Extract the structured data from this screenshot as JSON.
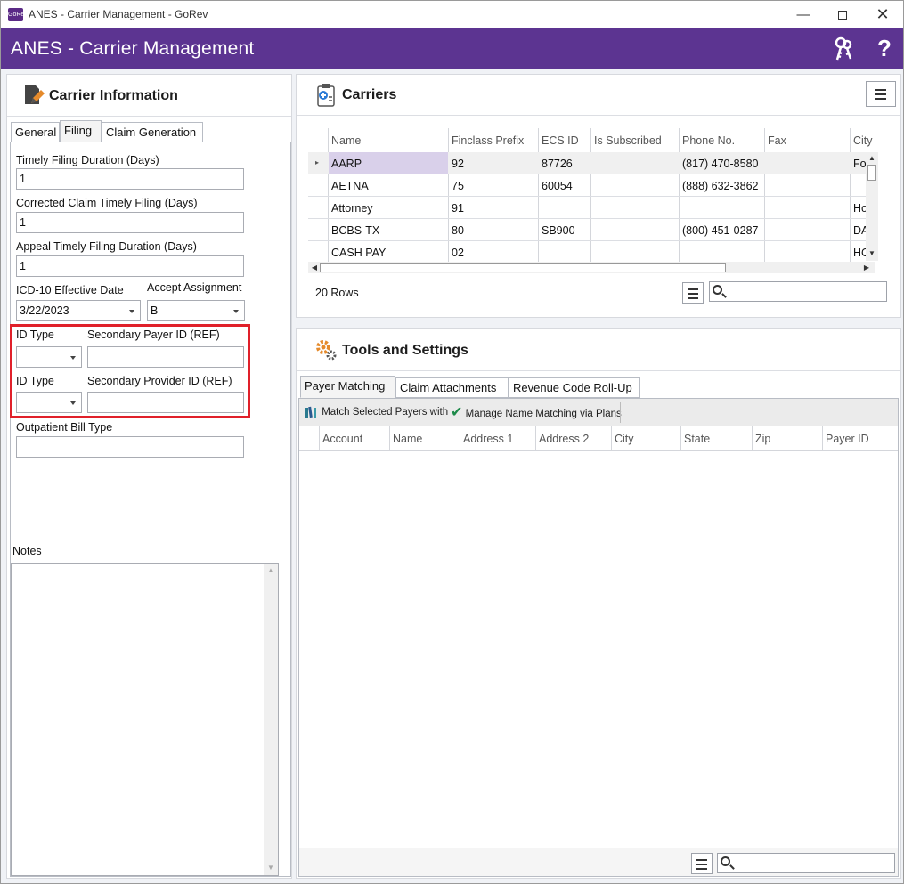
{
  "window": {
    "title": "ANES - Carrier Management - GoRev",
    "logo_text": "GoRev"
  },
  "header": {
    "app_name": "ANES - Carrier Management"
  },
  "carrier_info": {
    "title": "Carrier Information",
    "tabs": [
      "General",
      "Filing",
      "Claim Generation"
    ],
    "active_tab": "Filing",
    "fields": {
      "timely_label": "Timely Filing Duration (Days)",
      "timely_value": "1",
      "corrected_label": "Corrected Claim Timely Filing (Days)",
      "corrected_value": "1",
      "appeal_label": "Appeal Timely Filing Duration (Days)",
      "appeal_value": "1",
      "icd_label": "ICD-10 Effective Date",
      "icd_value": "3/22/2023",
      "accept_label": "Accept Assignment",
      "accept_value": "B",
      "id_type_label_1": "ID Type",
      "sec_payer_label": "Secondary Payer ID (REF)",
      "id_type_label_2": "ID Type",
      "sec_provider_label": "Secondary Provider ID (REF)",
      "outpatient_label": "Outpatient Bill Type",
      "notes_label": "Notes"
    }
  },
  "carriers": {
    "title": "Carriers",
    "columns": [
      "Name",
      "Finclass Prefix",
      "ECS ID",
      "Is Subscribed",
      "Phone No.",
      "Fax",
      "City"
    ],
    "rows": [
      [
        "AARP",
        "92",
        "87726",
        "",
        "(817) 470-8580",
        "",
        "Fort"
      ],
      [
        "AETNA",
        "75",
        "60054",
        "",
        "(888) 632-3862",
        "",
        ""
      ],
      [
        "Attorney",
        "91",
        "",
        "",
        "",
        "",
        "Hou"
      ],
      [
        "BCBS-TX",
        "80",
        "SB900",
        "",
        "(800) 451-0287",
        "",
        "DAL"
      ],
      [
        "CASH PAY",
        "02",
        "",
        "",
        "",
        "",
        "HOU"
      ]
    ],
    "row_count": "20 Rows"
  },
  "tools": {
    "title": "Tools and Settings",
    "tabs": [
      "Payer Matching",
      "Claim Attachments",
      "Revenue Code Roll-Up"
    ],
    "active_tab": "Payer Matching",
    "toolbar": {
      "match_label": "Match Selected Payers with",
      "manage_label": "Manage Name Matching via Plans"
    },
    "columns": [
      "Account",
      "Name",
      "Address 1",
      "Address 2",
      "City",
      "State",
      "Zip",
      "Payer ID"
    ]
  },
  "colors": {
    "header": "#5c3491",
    "highlight": "#e0202a",
    "selected_cell": "#d9d0ea"
  }
}
